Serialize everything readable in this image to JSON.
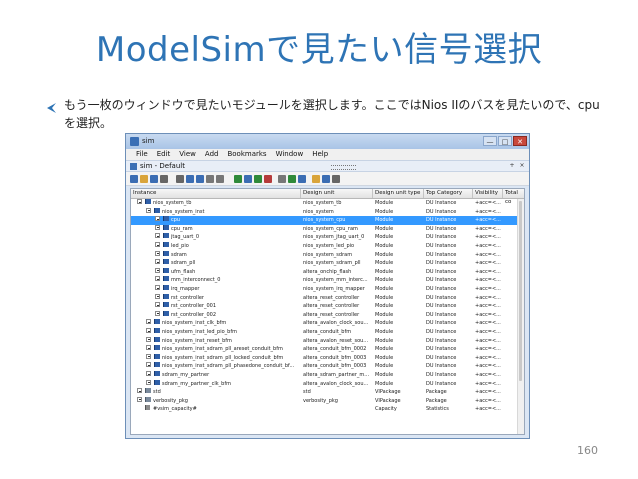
{
  "slide": {
    "title": "ModelSimで見たい信号選択",
    "bullet_text": "もう一枚のウィンドウで見たいモジュールを選択します。ここではNios IIのバスを見たいので、cpuを選択。",
    "page_number": "160",
    "accent_color": "#2e74b5"
  },
  "window": {
    "title": "sim",
    "buttons": [
      "—",
      "□",
      "✕"
    ],
    "menu": [
      "File",
      "Edit",
      "View",
      "Add",
      "Bookmarks",
      "Window",
      "Help"
    ],
    "pane_title": "sim - Default",
    "pane_buttons": [
      "+",
      "×"
    ]
  },
  "toolbar": {
    "icons": [
      "new-icon",
      "open-icon",
      "save-icon",
      "print-icon",
      "cut-icon",
      "copy-icon",
      "paste-icon",
      "undo-icon",
      "redo-icon",
      "find-icon",
      "step-icon",
      "run-icon",
      "zoom-icon",
      "break-icon",
      "wave-icon",
      "compile-icon",
      "restart-icon",
      "next-icon",
      "layout-icon"
    ]
  },
  "table": {
    "columns": [
      "Instance",
      "Design unit",
      "Design unit type",
      "Top Category",
      "Visibility",
      "Total co"
    ],
    "rows": [
      {
        "indent": 0,
        "expander": "minus",
        "icon": "module",
        "instance": "nios_system_tb",
        "design_unit": "nios_system_tb",
        "type": "Module",
        "category": "DU Instance",
        "visibility": "+acc=<...",
        "selected": false
      },
      {
        "indent": 1,
        "expander": "minus",
        "icon": "module",
        "instance": "nios_system_inst",
        "design_unit": "nios_system",
        "type": "Module",
        "category": "DU Instance",
        "visibility": "+acc=<...",
        "selected": false
      },
      {
        "indent": 2,
        "expander": "plus",
        "icon": "module",
        "instance": "cpu",
        "design_unit": "nios_system_cpu",
        "type": "Module",
        "category": "DU Instance",
        "visibility": "+acc=<...",
        "selected": true
      },
      {
        "indent": 2,
        "expander": "plus",
        "icon": "module",
        "instance": "cpu_ram",
        "design_unit": "nios_system_cpu_ram",
        "type": "Module",
        "category": "DU Instance",
        "visibility": "+acc=<...",
        "selected": false
      },
      {
        "indent": 2,
        "expander": "plus",
        "icon": "module",
        "instance": "jtag_uart_0",
        "design_unit": "nios_system_jtag_uart_0",
        "type": "Module",
        "category": "DU Instance",
        "visibility": "+acc=<...",
        "selected": false
      },
      {
        "indent": 2,
        "expander": "plus",
        "icon": "module",
        "instance": "led_pio",
        "design_unit": "nios_system_led_pio",
        "type": "Module",
        "category": "DU Instance",
        "visibility": "+acc=<...",
        "selected": false
      },
      {
        "indent": 2,
        "expander": "plus",
        "icon": "module",
        "instance": "sdram",
        "design_unit": "nios_system_sdram",
        "type": "Module",
        "category": "DU Instance",
        "visibility": "+acc=<...",
        "selected": false
      },
      {
        "indent": 2,
        "expander": "plus",
        "icon": "module",
        "instance": "sdram_pll",
        "design_unit": "nios_system_sdram_pll",
        "type": "Module",
        "category": "DU Instance",
        "visibility": "+acc=<...",
        "selected": false
      },
      {
        "indent": 2,
        "expander": "plus",
        "icon": "module",
        "instance": "ufm_flash",
        "design_unit": "altera_onchip_flash",
        "type": "Module",
        "category": "DU Instance",
        "visibility": "+acc=<...",
        "selected": false
      },
      {
        "indent": 2,
        "expander": "plus",
        "icon": "module",
        "instance": "mm_interconnect_0",
        "design_unit": "nios_system_mm_interc...",
        "type": "Module",
        "category": "DU Instance",
        "visibility": "+acc=<...",
        "selected": false
      },
      {
        "indent": 2,
        "expander": "plus",
        "icon": "module",
        "instance": "irq_mapper",
        "design_unit": "nios_system_irq_mapper",
        "type": "Module",
        "category": "DU Instance",
        "visibility": "+acc=<...",
        "selected": false
      },
      {
        "indent": 2,
        "expander": "plus",
        "icon": "module",
        "instance": "rst_controller",
        "design_unit": "altera_reset_controller",
        "type": "Module",
        "category": "DU Instance",
        "visibility": "+acc=<...",
        "selected": false
      },
      {
        "indent": 2,
        "expander": "plus",
        "icon": "module",
        "instance": "rst_controller_001",
        "design_unit": "altera_reset_controller",
        "type": "Module",
        "category": "DU Instance",
        "visibility": "+acc=<...",
        "selected": false
      },
      {
        "indent": 2,
        "expander": "plus",
        "icon": "module",
        "instance": "rst_controller_002",
        "design_unit": "altera_reset_controller",
        "type": "Module",
        "category": "DU Instance",
        "visibility": "+acc=<...",
        "selected": false
      },
      {
        "indent": 1,
        "expander": "plus",
        "icon": "module",
        "instance": "nios_system_inst_clk_bfm",
        "design_unit": "altera_avalon_clock_sou...",
        "type": "Module",
        "category": "DU Instance",
        "visibility": "+acc=<...",
        "selected": false
      },
      {
        "indent": 1,
        "expander": "plus",
        "icon": "module",
        "instance": "nios_system_inst_led_pio_bfm",
        "design_unit": "altera_conduit_bfm",
        "type": "Module",
        "category": "DU Instance",
        "visibility": "+acc=<...",
        "selected": false
      },
      {
        "indent": 1,
        "expander": "plus",
        "icon": "module",
        "instance": "nios_system_inst_reset_bfm",
        "design_unit": "altera_avalon_reset_sou...",
        "type": "Module",
        "category": "DU Instance",
        "visibility": "+acc=<...",
        "selected": false
      },
      {
        "indent": 1,
        "expander": "plus",
        "icon": "module",
        "instance": "nios_system_inst_sdram_pll_areset_conduit_bfm",
        "design_unit": "altera_conduit_bfm_0002",
        "type": "Module",
        "category": "DU Instance",
        "visibility": "+acc=<...",
        "selected": false
      },
      {
        "indent": 1,
        "expander": "plus",
        "icon": "module",
        "instance": "nios_system_inst_sdram_pll_locked_conduit_bfm",
        "design_unit": "altera_conduit_bfm_0003",
        "type": "Module",
        "category": "DU Instance",
        "visibility": "+acc=<...",
        "selected": false
      },
      {
        "indent": 1,
        "expander": "plus",
        "icon": "module",
        "instance": "nios_system_inst_sdram_pll_phasedone_conduit_bf...",
        "design_unit": "altera_conduit_bfm_0003",
        "type": "Module",
        "category": "DU Instance",
        "visibility": "+acc=<...",
        "selected": false
      },
      {
        "indent": 1,
        "expander": "plus",
        "icon": "module",
        "instance": "sdram_my_partner",
        "design_unit": "altera_sdram_partner_m...",
        "type": "Module",
        "category": "DU Instance",
        "visibility": "+acc=<...",
        "selected": false
      },
      {
        "indent": 1,
        "expander": "plus",
        "icon": "module",
        "instance": "sdram_my_partner_clk_bfm",
        "design_unit": "altera_avalon_clock_sou...",
        "type": "Module",
        "category": "DU Instance",
        "visibility": "+acc=<...",
        "selected": false
      },
      {
        "indent": 0,
        "expander": "plus",
        "icon": "package",
        "instance": "std",
        "design_unit": "std",
        "type": "VIPackage",
        "category": "Package",
        "visibility": "+acc=<...",
        "selected": false
      },
      {
        "indent": 0,
        "expander": "plus",
        "icon": "package",
        "instance": "verbosity_pkg",
        "design_unit": "verbosity_pkg",
        "type": "VIPackage",
        "category": "Package",
        "visibility": "+acc=<...",
        "selected": false
      },
      {
        "indent": 0,
        "expander": "none",
        "icon": "capacity",
        "instance": "#vsim_capacity#",
        "design_unit": "",
        "type": "Capacity",
        "category": "Statistics",
        "visibility": "+acc=<...",
        "selected": false
      }
    ]
  }
}
